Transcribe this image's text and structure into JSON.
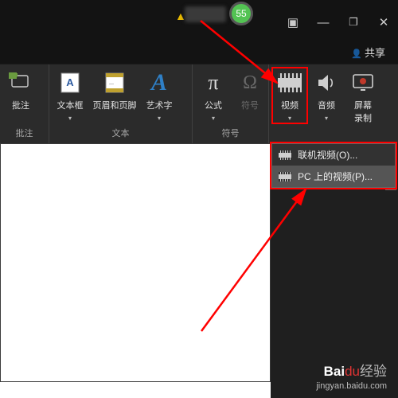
{
  "titlebar": {
    "badge": "55"
  },
  "share": {
    "label": "共享"
  },
  "ribbon": {
    "comments": {
      "tool": "批注",
      "group": "批注"
    },
    "text": {
      "group": "文本",
      "textbox": "文本框",
      "header_footer": "页眉和页脚",
      "wordart": "艺术字"
    },
    "symbols": {
      "group": "符号",
      "equation": "公式",
      "symbol": "符号"
    },
    "media": {
      "video": "视频",
      "audio": "音频",
      "screen_rec": "屏幕\n录制"
    }
  },
  "dropdown": {
    "online": "联机视频(O)...",
    "pc": "PC 上的视频(P)..."
  },
  "watermark": {
    "brand_a": "Bai",
    "brand_b": "du",
    "brand_c": "经验",
    "url": "jingyan.baidu.com"
  }
}
